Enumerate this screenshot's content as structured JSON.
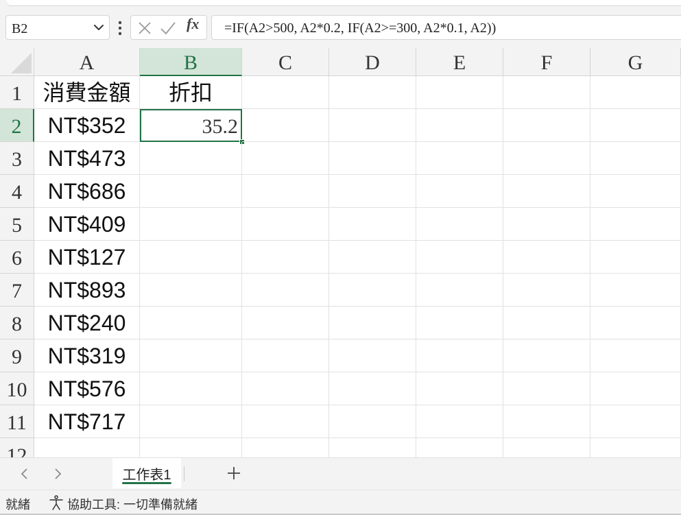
{
  "formula_bar": {
    "name_box": "B2",
    "fx_label": "fx",
    "formula": "=IF(A2>500, A2*0.2, IF(A2>=300, A2*0.1, A2))"
  },
  "columns": [
    "A",
    "B",
    "C",
    "D",
    "E",
    "F",
    "G"
  ],
  "rows": [
    "1",
    "2",
    "3",
    "4",
    "5",
    "6",
    "7",
    "8",
    "9",
    "10",
    "11",
    "12"
  ],
  "cells": {
    "A1": "消費金額",
    "B1": "折扣",
    "A2": "NT$352",
    "B2": "35.2",
    "A3": "NT$473",
    "A4": "NT$686",
    "A5": "NT$409",
    "A6": "NT$127",
    "A7": "NT$893",
    "A8": "NT$240",
    "A9": "NT$319",
    "A10": "NT$576",
    "A11": "NT$717"
  },
  "selection": {
    "cell": "B2",
    "column": "B",
    "row": "2"
  },
  "sheet_tabs": {
    "active": "工作表1",
    "add_label": "+"
  },
  "status_bar": {
    "ready": "就緒",
    "accessibility": "協助工具: 一切準備就緒"
  },
  "colors": {
    "accent": "#217346",
    "header_active": "#d3e5d8",
    "chrome": "#f3f3f3"
  }
}
